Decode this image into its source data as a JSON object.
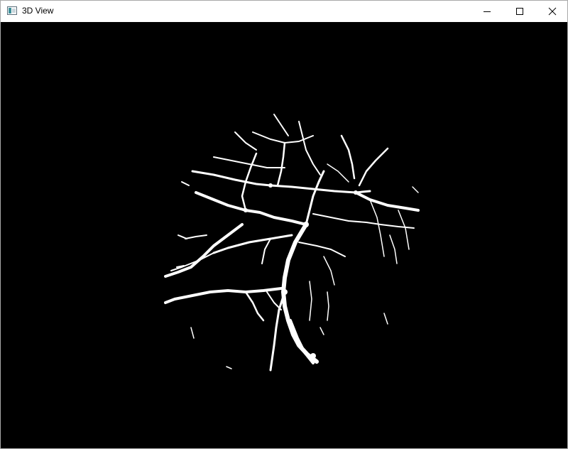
{
  "window": {
    "title": "3D View",
    "icon": "app-window-icon",
    "controls": [
      "minimize-icon",
      "maximize-icon",
      "close-icon"
    ]
  },
  "viewport": {
    "background": "#000000",
    "content": "rendered-vessel-network",
    "foreground": "#ffffff"
  }
}
